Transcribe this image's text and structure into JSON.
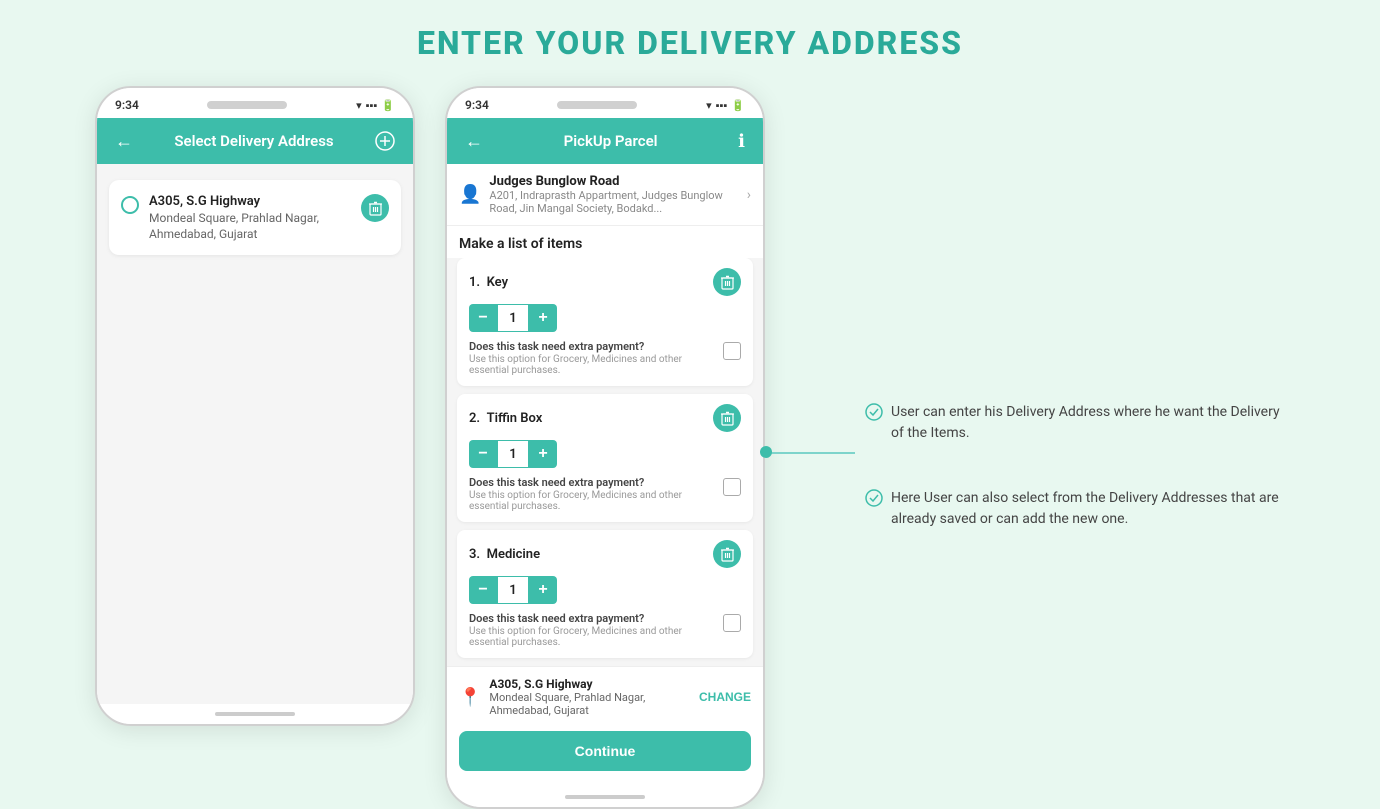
{
  "page": {
    "title": "ENTER YOUR DELIVERY ADDRESS",
    "bg_color": "#e8f8f0",
    "accent_color": "#3dbdaa"
  },
  "phone1": {
    "time": "9:34",
    "header": {
      "back_label": "←",
      "title": "Select Delivery Address",
      "add_label": "+"
    },
    "address": {
      "line1": "A305, S.G Highway",
      "line2": "Mondeal Square, Prahlad Nagar,",
      "line3": "Ahmedabad, Gujarat"
    }
  },
  "phone2": {
    "time": "9:34",
    "header": {
      "back_label": "←",
      "title": "PickUp Parcel",
      "info_label": "ℹ"
    },
    "pickup_address": {
      "line1": "Judges Bunglow Road",
      "line2": "A201, Indraprasth Appartment, Judges Bunglow Road, Jin Mangal Society, Bodakd..."
    },
    "items_section_title": "Make a list of items",
    "items": [
      {
        "number": "1.",
        "name": "Key",
        "quantity": 1,
        "extra_payment_label": "Does this task need extra payment?",
        "extra_payment_desc": "Use this option for Grocery, Medicines and other essential purchases."
      },
      {
        "number": "2.",
        "name": "Tiffin Box",
        "quantity": 1,
        "extra_payment_label": "Does this task need extra payment?",
        "extra_payment_desc": "Use this option for Grocery, Medicines and other essential purchases."
      },
      {
        "number": "3.",
        "name": "Medicine",
        "quantity": 1,
        "extra_payment_label": "Does this task need extra payment?",
        "extra_payment_desc": "Use this option for Grocery, Medicines and other essential purchases."
      }
    ],
    "delivery_address": {
      "line1": "A305, S.G Highway",
      "line2": "Mondeal Square, Prahlad Nagar,",
      "line3": "Ahmedabad, Gujarat",
      "change_label": "CHANGE"
    },
    "continue_label": "Continue"
  },
  "annotations": [
    {
      "text": "User can enter his Delivery Address where he want the Delivery of the Items."
    },
    {
      "text": "Here User can also select from the Delivery Addresses that are already saved or can add the new one."
    }
  ]
}
